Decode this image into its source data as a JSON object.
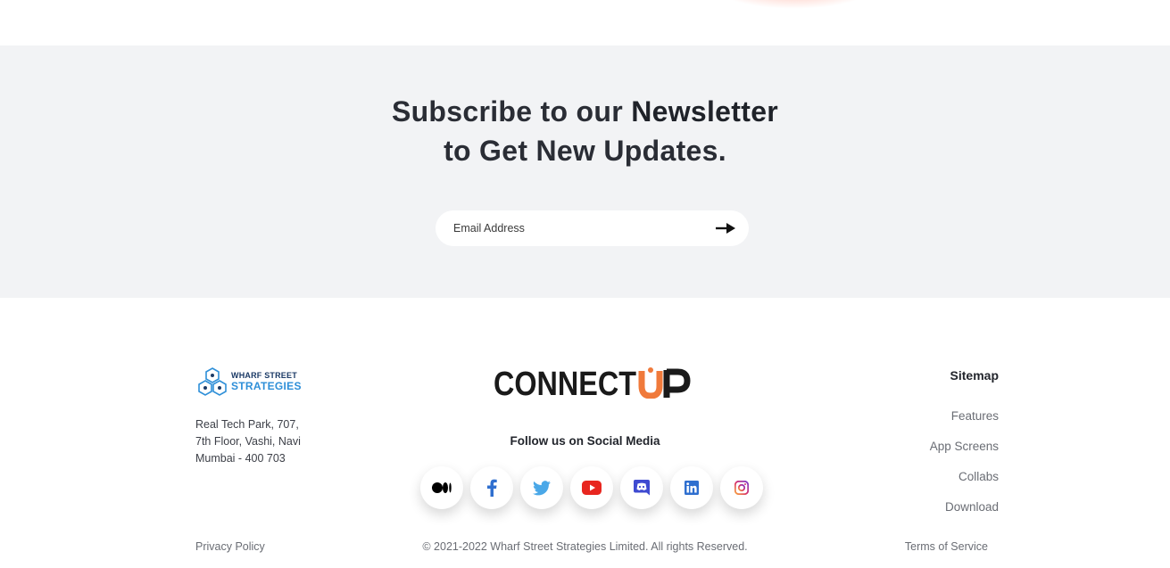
{
  "newsletter": {
    "title_prefix": "Subscribe to our",
    "title_bold": "Newsletter",
    "title_line2": "to Get New Updates.",
    "email_placeholder": "Email Address"
  },
  "footer": {
    "company_logo_line1": "WHARF STREET",
    "company_logo_line2": "STRATEGIES",
    "address_line1": "Real Tech Park, 707,",
    "address_line2": "7th Floor, Vashi, Navi",
    "address_line3": "Mumbai - 400 703",
    "brand_logo_text": "CONNECTUP",
    "follow_label": "Follow us on Social Media",
    "socials": [
      {
        "name": "medium",
        "icon": "medium-icon",
        "color": "#000000"
      },
      {
        "name": "facebook",
        "icon": "facebook-icon",
        "color": "#2f6fcf"
      },
      {
        "name": "twitter",
        "icon": "twitter-icon",
        "color": "#4aa8e8"
      },
      {
        "name": "youtube",
        "icon": "youtube-icon",
        "color": "#e8261f"
      },
      {
        "name": "discord",
        "icon": "discord-icon",
        "color": "#3f4bd1"
      },
      {
        "name": "linkedin",
        "icon": "linkedin-icon",
        "color": "#2f6fcf"
      },
      {
        "name": "instagram",
        "icon": "instagram-icon",
        "color": "#d6306e"
      }
    ],
    "sitemap_title": "Sitemap",
    "sitemap_links": [
      "Features",
      "App Screens",
      "Collabs",
      "Download"
    ],
    "privacy": "Privacy Policy",
    "copyright": "© 2021-2022 Wharf Street Strategies Limited. All rights Reserved.",
    "terms": "Terms of Service"
  },
  "colors": {
    "newsletter_bg": "#f2f3f5",
    "brand_orange": "#f07a3b",
    "brand_blue": "#2e8fd8"
  }
}
